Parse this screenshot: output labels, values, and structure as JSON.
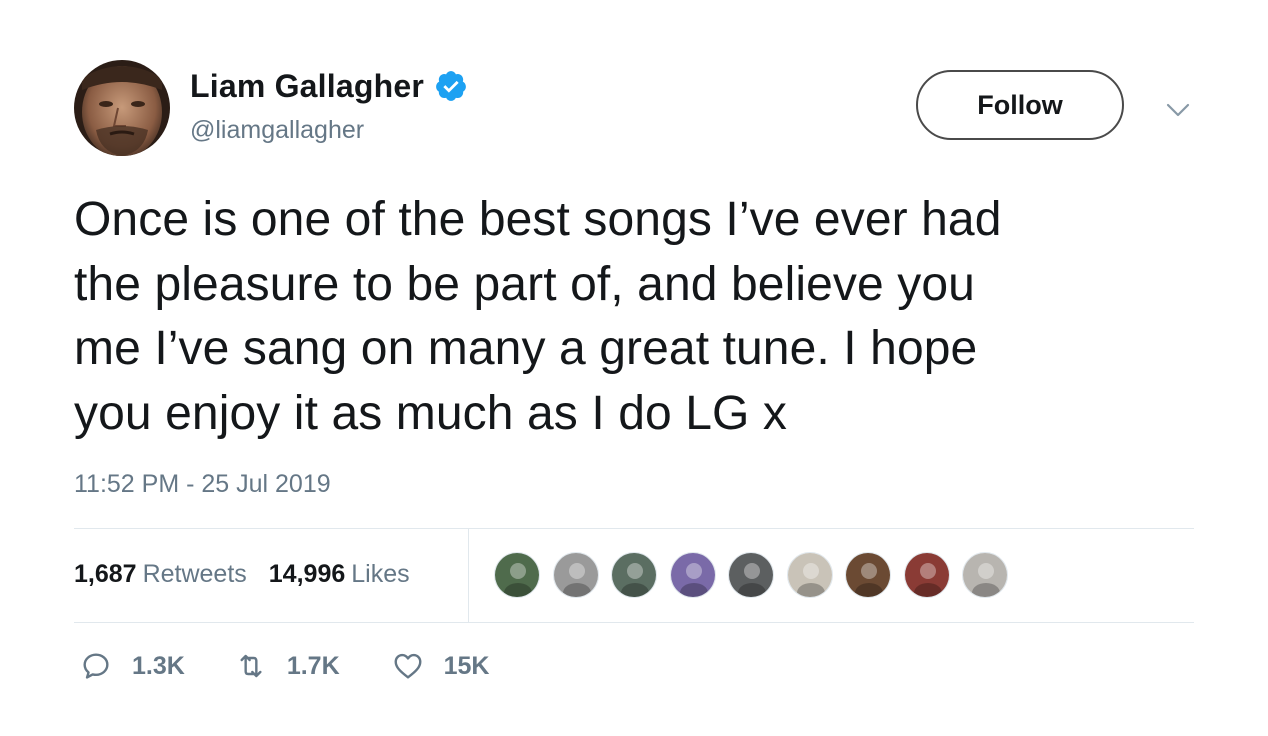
{
  "author": {
    "display_name": "Liam Gallagher",
    "handle": "@liamgallagher",
    "verified": true,
    "avatar_icon": "profile-photo",
    "verified_icon": "verified-badge-icon",
    "verified_color": "#1da1f2"
  },
  "follow_button": {
    "label": "Follow"
  },
  "menu": {
    "icon": "chevron-down-icon"
  },
  "tweet": {
    "lines": [
      "Once is one of the best songs I’ve ever had",
      "the pleasure to be part of, and believe you",
      "me I’ve sang on many a great tune. I hope",
      "you enjoy it as much as I do LG x"
    ],
    "timestamp": "11:52 PM - 25 Jul 2019"
  },
  "stats": {
    "retweets_count": "1,687",
    "retweets_label": "Retweets",
    "likes_count": "14,996",
    "likes_label": "Likes"
  },
  "likers": [
    {
      "icon": "liker-avatar-1",
      "color": "#4f6b4c"
    },
    {
      "icon": "liker-avatar-2",
      "color": "#9a9a9a"
    },
    {
      "icon": "liker-avatar-3",
      "color": "#5b6e62"
    },
    {
      "icon": "liker-avatar-4",
      "color": "#7a6aa8"
    },
    {
      "icon": "liker-avatar-5",
      "color": "#5c5f60"
    },
    {
      "icon": "liker-avatar-6",
      "color": "#c9c3b8"
    },
    {
      "icon": "liker-avatar-7",
      "color": "#6b4a33"
    },
    {
      "icon": "liker-avatar-8",
      "color": "#8a3b35"
    },
    {
      "icon": "liker-avatar-9",
      "color": "#b8b5b0"
    }
  ],
  "actions": {
    "reply": {
      "icon": "reply-icon",
      "count": "1.3K"
    },
    "retweet": {
      "icon": "retweet-icon",
      "count": "1.7K"
    },
    "like": {
      "icon": "heart-icon",
      "count": "15K"
    }
  },
  "colors": {
    "text": "#14171a",
    "secondary": "#657786",
    "divider": "#e1e8ed",
    "accent": "#1da1f2"
  }
}
